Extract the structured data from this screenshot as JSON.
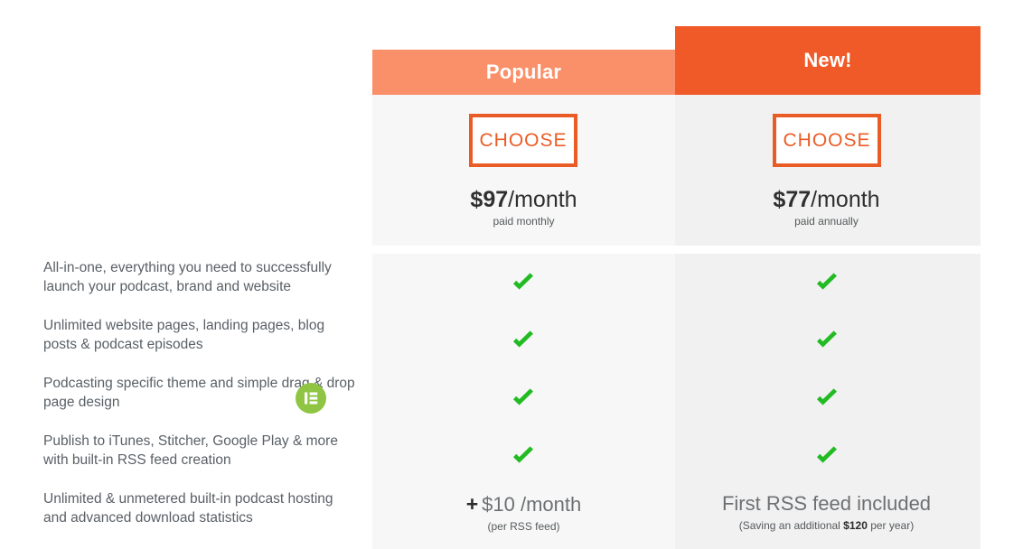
{
  "theme": {
    "accent_light": "#FA9069",
    "accent_dark": "#F05A28",
    "button_border": "#EA5C26",
    "check_green": "#22BB22",
    "badge_green": "#8FC542",
    "col_bg_left": "#F7F7F7",
    "col_bg_right": "#F1F1F1",
    "text_gray": "#5A6066"
  },
  "plans": [
    {
      "badge": "Popular",
      "choose_label": "CHOOSE",
      "price_amount": "$97",
      "price_period": "/month",
      "price_note": "paid monthly",
      "features_included": [
        true,
        true,
        true,
        true
      ],
      "footer_main_prefix": "+",
      "footer_main": "$10 /month",
      "footer_sub": "(per RSS feed)"
    },
    {
      "badge": "New!",
      "choose_label": "CHOOSE",
      "price_amount": "$77",
      "price_period": "/month",
      "price_note": "paid annually",
      "features_included": [
        true,
        true,
        true,
        true
      ],
      "footer_main_prefix": "",
      "footer_main": "First RSS feed included",
      "footer_sub_prefix": "(Saving an additional ",
      "footer_sub_strong": "$120",
      "footer_sub_suffix": " per year)"
    }
  ],
  "features": [
    "All-in-one, everything you need to successfully launch your podcast, brand and website",
    "Unlimited website pages, landing pages, blog posts & podcast episodes",
    "Podcasting specific theme and simple drag & drop page design",
    "Publish to iTunes, Stitcher, Google Play & more with built-in RSS feed creation",
    "Unlimited & unmetered built-in podcast hosting and advanced download statistics"
  ],
  "icons": {
    "check": "check-icon",
    "badge_logo": "elementor-logo-icon",
    "plus": "plus-icon"
  }
}
